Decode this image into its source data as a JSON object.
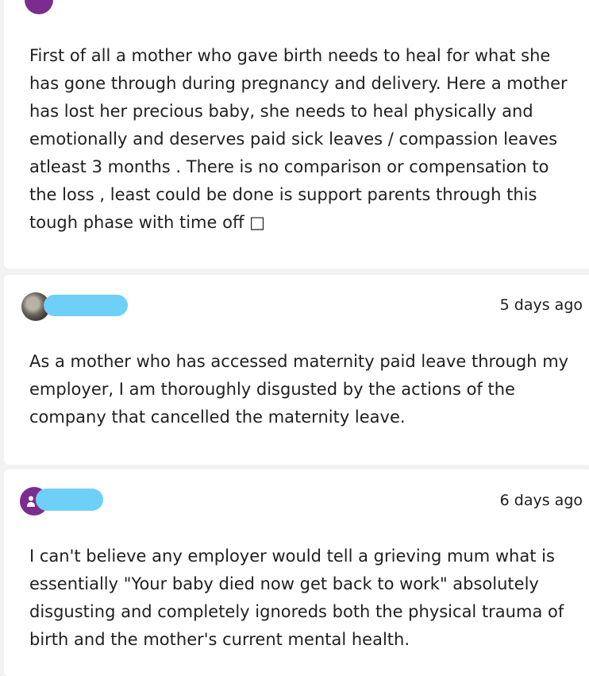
{
  "comments": [
    {
      "avatar": "user-avatar-purple",
      "text": "First of all a mother who gave birth needs to heal for what she\nhas gone through during pregnancy and delivery. Here a mother\nhas lost her precious baby, she needs to heal physically and\nemotionally and deserves paid sick leaves / compassion leaves\natleast 3 months . There is no comparison or compensation to\nthe loss , least could be done is support parents through this\ntough phase with time off □"
    },
    {
      "avatar": "user-avatar-photo",
      "time": "5 days ago",
      "text": "As a mother who has accessed maternity paid leave through my\nemployer, I am thoroughly disgusted by the actions of the\ncompany that cancelled the maternity leave."
    },
    {
      "avatar": "user-avatar-purple",
      "time": "6 days ago",
      "text": "I can't believe any employer would tell a grieving mum what is\nessentially \"Your baby died now get back to work\" absolutely\ndisgusting and completely ignoreds both the physical trauma of\nbirth and the mother's current mental health."
    }
  ],
  "colors": {
    "page_background": "#f2f2f2",
    "card_background": "#ffffff",
    "avatar_purple": "#7b2d8e",
    "redaction": "#6fd0f7"
  }
}
